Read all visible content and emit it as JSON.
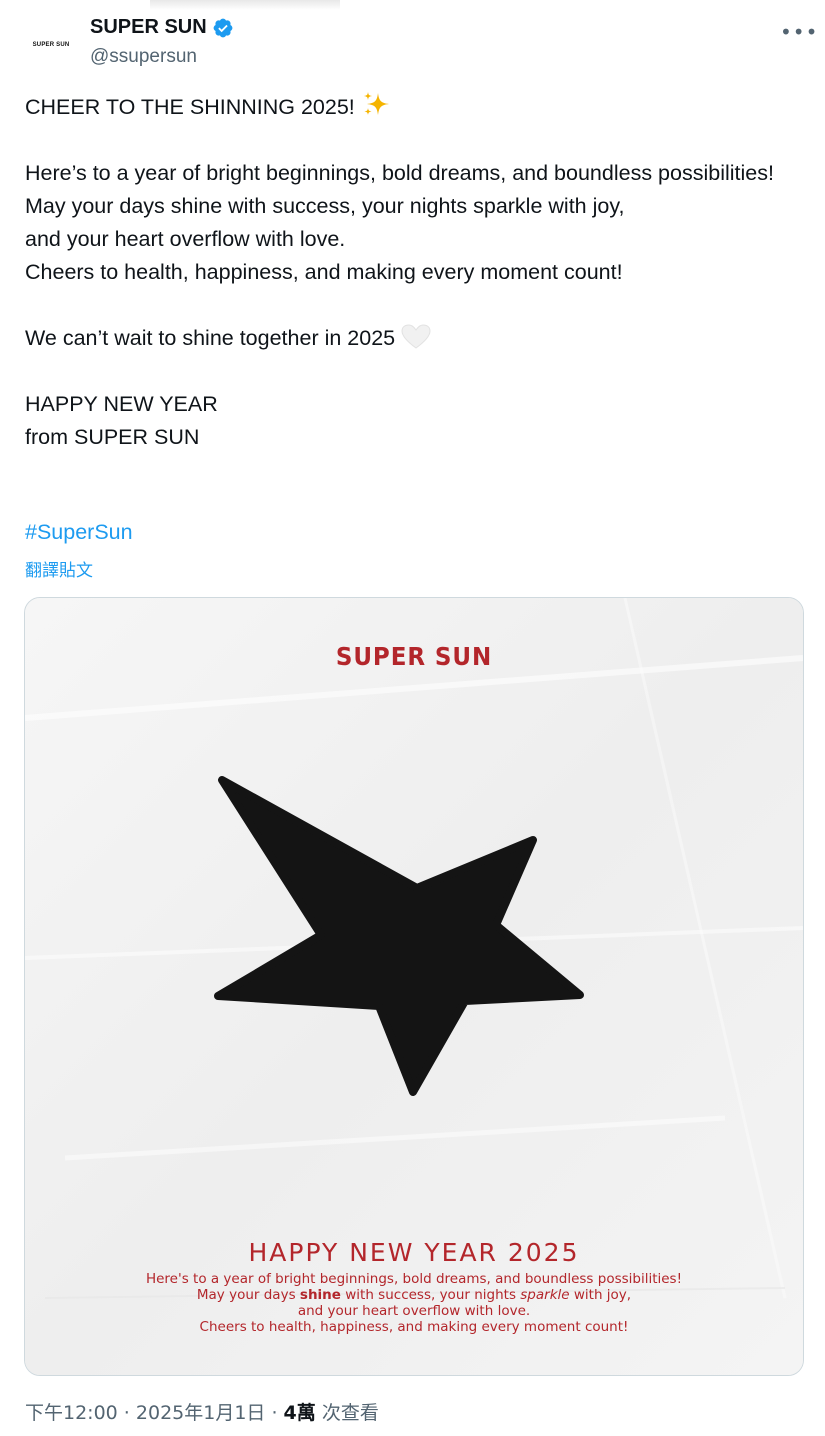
{
  "author": {
    "avatar_text": "SUPER SUN",
    "display_name": "SUPER SUN",
    "handle": "@ssupersun",
    "verified_icon": "verified-badge-icon"
  },
  "post": {
    "line1": "CHEER TO THE SHINNING 2025!",
    "line1_emoji": "sparkles-icon",
    "para1": "Here’s to a year of bright beginnings, bold dreams, and boundless possibilities!\nMay your days shine with success, your nights sparkle with joy,\nand your heart overflow with love.\nCheers to health, happiness, and making every moment count!",
    "line_together": "We can’t wait to shine together in 2025",
    "line_together_emoji": "white-heart-icon",
    "closing1": "HAPPY NEW YEAR",
    "closing2": "from SUPER SUN",
    "hashtag": "#SuperSun",
    "translate_label": "翻譯貼文"
  },
  "image": {
    "brand": "SUPER SUN",
    "title": "HAPPY NEW YEAR 2025",
    "l1": "Here's to a year of bright beginnings, bold dreams, and boundless possibilities!",
    "l2_a": "May your days ",
    "l2_bold": "shine",
    "l2_b": " with success, your nights ",
    "l2_ital": "sparkle",
    "l2_c": " with joy,",
    "l3": "and your heart overflow with love.",
    "l4": "Cheers to health, happiness, and making every moment count!"
  },
  "meta": {
    "time": "下午12:00",
    "sep": " · ",
    "date": "2025年1月1日",
    "sep2": " · ",
    "views_count": "4萬",
    "views_label": " 次查看"
  },
  "colors": {
    "link": "#1d9bf0",
    "brand_red": "#b3262b",
    "text": "#0f1419",
    "muted": "#536471"
  }
}
